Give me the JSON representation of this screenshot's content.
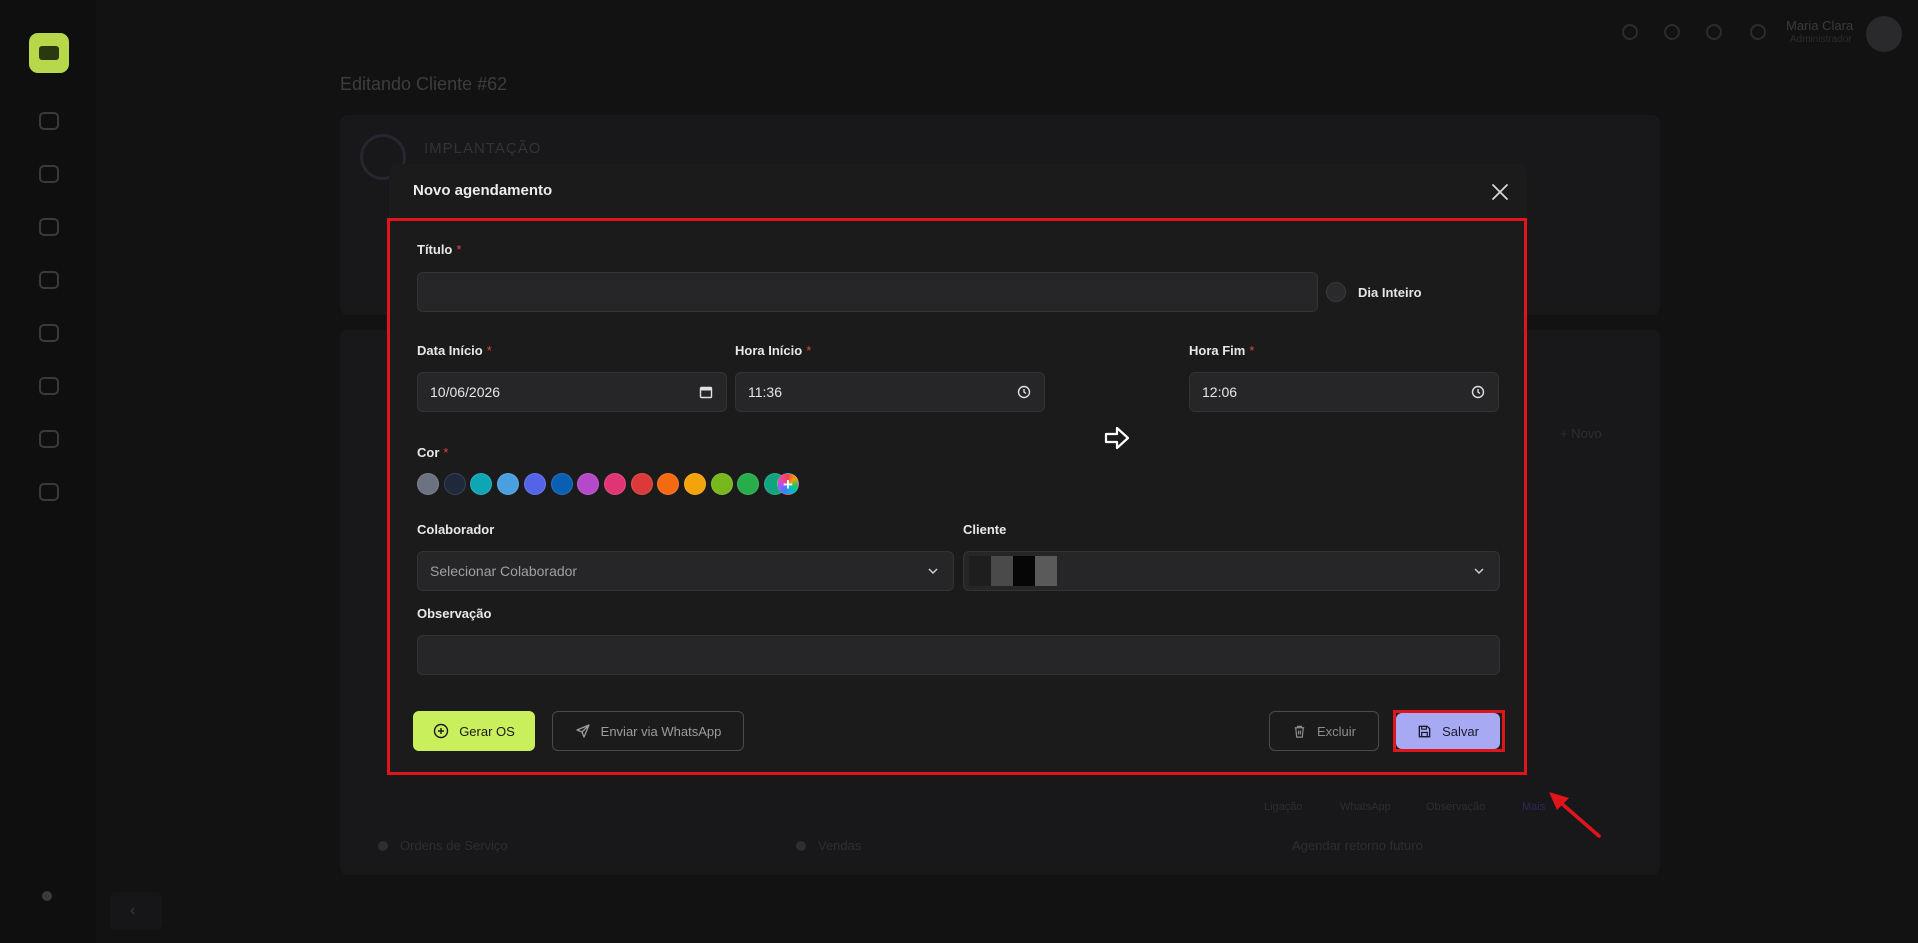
{
  "background": {
    "page_title": "Editando Cliente #62",
    "section_label": "IMPLANTAÇÃO",
    "user": {
      "name": "Maria Clara",
      "role": "Administrador"
    },
    "tabs": [
      "Ordens de Serviço",
      "Vendas"
    ],
    "actions": [
      "Ligação",
      "WhatsApp",
      "Observação",
      "Mais"
    ],
    "schedule_link": "Agendar retorno futuro",
    "new_label": "+ Novo"
  },
  "modal": {
    "title": "Novo agendamento",
    "fields": {
      "titulo": {
        "label": "Título",
        "required_mark": "*",
        "value": ""
      },
      "dia_inteiro": {
        "label": "Dia Inteiro"
      },
      "data_inicio": {
        "label": "Data Início",
        "required_mark": "*",
        "value": "10/06/2026"
      },
      "hora_inicio": {
        "label": "Hora Início",
        "required_mark": "*",
        "value": "11:36"
      },
      "hora_fim": {
        "label": "Hora Fim",
        "required_mark": "*",
        "value": "12:06"
      },
      "cor": {
        "label": "Cor",
        "required_mark": "*",
        "colors": [
          "#6b7280",
          "#1e293b",
          "#0ea5b5",
          "#4a9fe0",
          "#5563e8",
          "#0b5fb3",
          "#b649c9",
          "#e03575",
          "#dc3a3a",
          "#f26a12",
          "#f5a30b",
          "#77b81c",
          "#27ad4a",
          "#12a37f"
        ]
      },
      "colaborador": {
        "label": "Colaborador",
        "placeholder": "Selecionar Colaborador"
      },
      "cliente": {
        "label": "Cliente",
        "value": ""
      },
      "observacao": {
        "label": "Observação",
        "value": ""
      }
    },
    "buttons": {
      "gerar_os": "Gerar OS",
      "enviar_whatsapp": "Enviar via WhatsApp",
      "excluir": "Excluir",
      "salvar": "Salvar"
    }
  },
  "colors": {
    "accent_green": "#c9ef5d",
    "accent_purple": "#a7a9f2",
    "highlight_red": "#e0141b"
  }
}
